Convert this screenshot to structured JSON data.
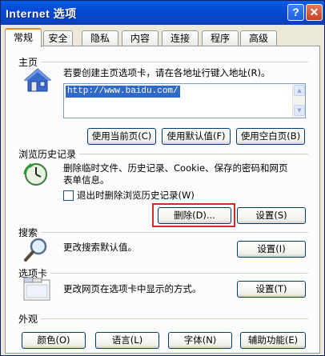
{
  "window": {
    "title": "Internet 选项",
    "help_label": "?",
    "close_label": "✕"
  },
  "tabs": [
    {
      "label": "常规",
      "active": true
    },
    {
      "label": "安全"
    },
    {
      "label": "隐私"
    },
    {
      "label": "内容"
    },
    {
      "label": "连接"
    },
    {
      "label": "程序"
    },
    {
      "label": "高级"
    }
  ],
  "homepage": {
    "section_title": "主页",
    "description": "若要创建主页选项卡，请在各地址行键入地址(R)。",
    "address_value": "http://www.baidu.com/",
    "use_current_label": "使用当前页(C)",
    "use_default_label": "使用默认值(F)",
    "use_blank_label": "使用空白页(B)"
  },
  "history": {
    "section_title": "浏览历史记录",
    "description_line1": "删除临时文件、历史记录、Cookie、保存的密码和网页",
    "description_line2": "表单信息。",
    "delete_on_exit_label": "退出时删除浏览历史记录(W)",
    "delete_on_exit_checked": false,
    "delete_label": "删除(D)...",
    "settings_label": "设置(S)"
  },
  "search": {
    "section_title": "搜索",
    "description": "更改搜索默认值。",
    "settings_label": "设置(I)"
  },
  "tabs_section": {
    "section_title": "选项卡",
    "description": "更改网页在选项卡中显示的方式。",
    "settings_label": "设置(T)"
  },
  "appearance": {
    "section_title": "外观",
    "colors_label": "颜色(O)",
    "languages_label": "语言(L)",
    "fonts_label": "字体(N)",
    "accessibility_label": "辅助功能(E)"
  }
}
